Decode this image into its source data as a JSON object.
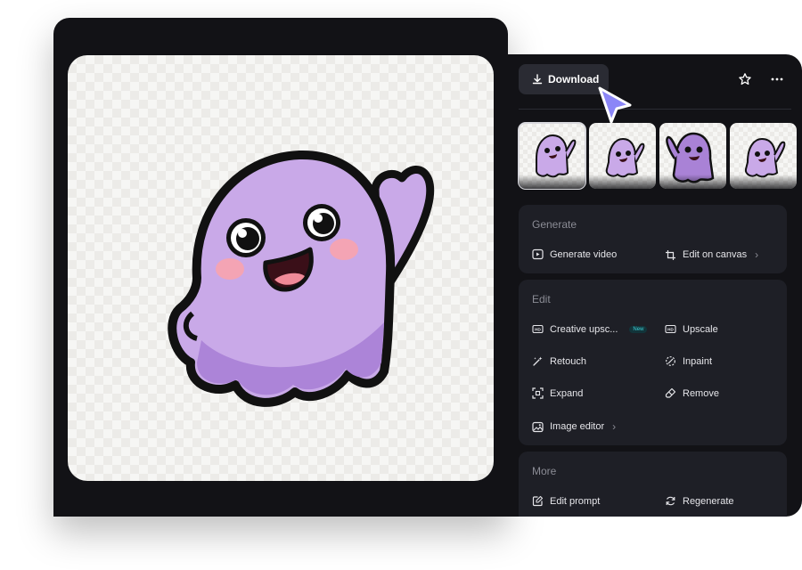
{
  "toolbar": {
    "download_label": "Download",
    "star_icon": "star-icon",
    "more_icon": "more-horizontal-icon"
  },
  "thumbnails": [
    {
      "name": "thumbnail-1",
      "selected": true
    },
    {
      "name": "thumbnail-2",
      "selected": false
    },
    {
      "name": "thumbnail-3",
      "selected": false
    },
    {
      "name": "thumbnail-4",
      "selected": false
    }
  ],
  "sections": {
    "generate": {
      "title": "Generate",
      "items": [
        {
          "label": "Generate video",
          "icon": "play-icon"
        },
        {
          "label": "Edit on canvas",
          "icon": "crop-icon",
          "chevron": "›"
        }
      ]
    },
    "edit": {
      "title": "Edit",
      "items": [
        {
          "label": "Creative upsc...",
          "icon": "hd-icon",
          "badge": "New"
        },
        {
          "label": "Upscale",
          "icon": "hd-icon"
        },
        {
          "label": "Retouch",
          "icon": "magic-wand-icon"
        },
        {
          "label": "Inpaint",
          "icon": "inpaint-icon"
        },
        {
          "label": "Expand",
          "icon": "expand-icon"
        },
        {
          "label": "Remove",
          "icon": "eraser-icon"
        },
        {
          "label": "Image editor",
          "icon": "image-edit-icon",
          "chevron": "›"
        }
      ]
    },
    "more": {
      "title": "More",
      "items": [
        {
          "label": "Edit prompt",
          "icon": "edit-prompt-icon"
        },
        {
          "label": "Regenerate",
          "icon": "regenerate-icon"
        }
      ]
    }
  },
  "colors": {
    "panel_bg": "#121216",
    "card_bg": "#1e1f26",
    "button_bg": "#2a2b33",
    "cursor": "#8b86f7",
    "ghost": "#c6a9e6",
    "new_badge": "#3fd0d8"
  }
}
